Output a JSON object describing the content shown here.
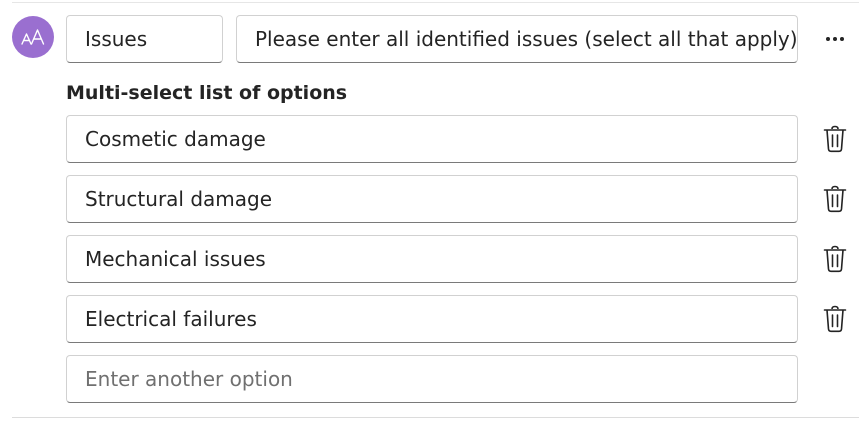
{
  "question": {
    "type_label": "Issues",
    "prompt": "Please enter all identified issues (select all that apply)"
  },
  "section_title": "Multi-select list of options",
  "options": [
    {
      "label": "Cosmetic damage"
    },
    {
      "label": "Structural damage"
    },
    {
      "label": "Mechanical issues"
    },
    {
      "label": "Electrical failures"
    }
  ],
  "new_option_placeholder": "Enter another option",
  "icons": {
    "avatar": "text-style-icon",
    "more": "more-horizontal-icon",
    "delete": "trash-icon"
  },
  "colors": {
    "avatar": "#9a6fd0",
    "border": "#d1d1d1",
    "text": "#242424",
    "placeholder": "#707070"
  }
}
